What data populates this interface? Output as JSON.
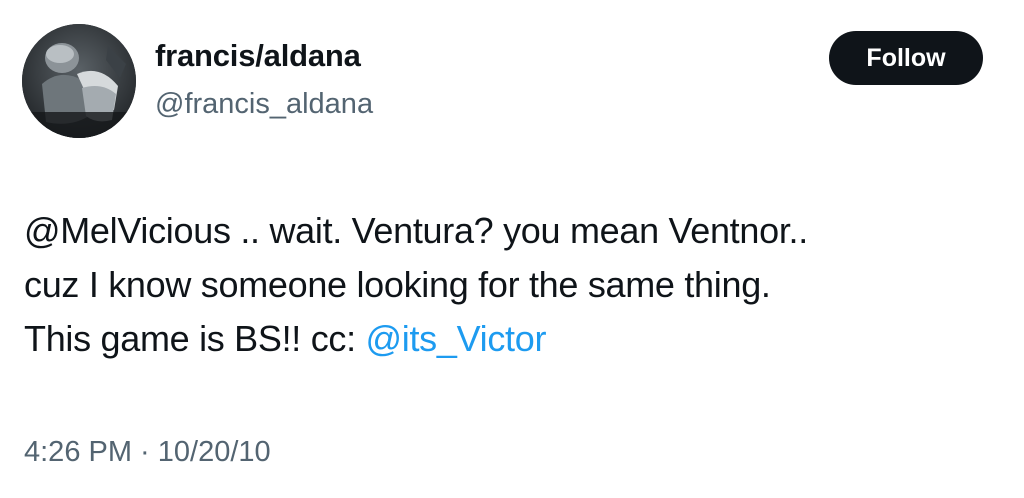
{
  "user": {
    "display_name": "francis/aldana",
    "handle": "@francis_aldana"
  },
  "follow_button": {
    "label": "Follow"
  },
  "tweet": {
    "line1": "@MelVicious .. wait. Ventura? you mean Ventnor..",
    "line2": "cuz I know someone looking for the same thing.",
    "line3_text": "This game is BS!! cc: ",
    "line3_mention": "@its_Victor",
    "timestamp": "4:26 PM · 10/20/10"
  },
  "colors": {
    "link": "#1d9bf0",
    "secondary_text": "#536471",
    "follow_bg": "#0f1419"
  },
  "icons": {
    "avatar": "user-avatar-photo"
  }
}
